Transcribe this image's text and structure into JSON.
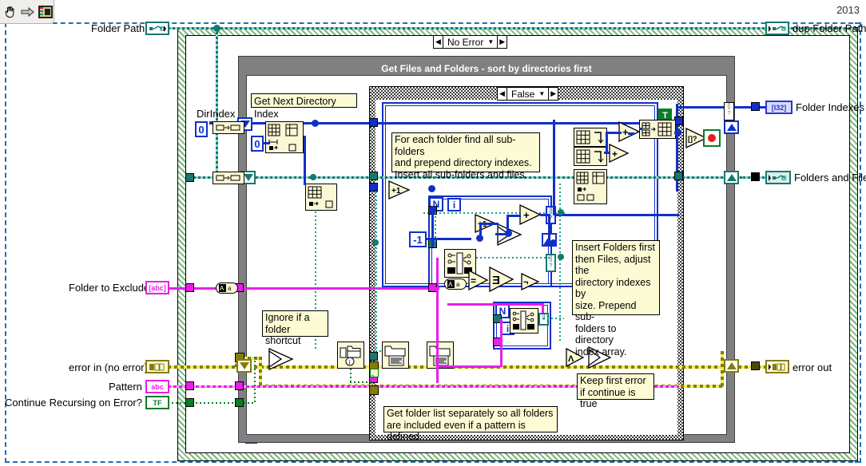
{
  "window": {
    "year_badge": "2013",
    "toolbar": {
      "items": [
        {
          "name": "hand-tool",
          "label": "Hand Tool"
        },
        {
          "name": "run-arrow",
          "label": "Run"
        },
        {
          "name": "vi-icon",
          "label": "VI Icon"
        }
      ]
    }
  },
  "structures": {
    "while_loop_selector": "No Error",
    "case_title": "Get Files and Folders - sort by directories first",
    "inner_case_selector": "False",
    "loop_index_label": "i",
    "count_label": "N"
  },
  "inputs": [
    {
      "name": "folder-path",
      "label": "Folder Path",
      "type": "path",
      "glyph": "path"
    },
    {
      "name": "folder-to-exclude",
      "label": "Folder to Exclude",
      "type": "string",
      "glyph": "[abc]"
    },
    {
      "name": "error-in",
      "label": "error in (no error)",
      "type": "error",
      "glyph": "err"
    },
    {
      "name": "pattern",
      "label": "Pattern",
      "type": "string",
      "glyph": "abc"
    },
    {
      "name": "continue-recursing",
      "label": "Continue Recursing on Error? (F)",
      "type": "boolean",
      "glyph": "TF"
    }
  ],
  "outputs": [
    {
      "name": "dup-folder-path",
      "label": "dup Folder Path",
      "type": "path",
      "glyph": "path"
    },
    {
      "name": "folder-indexes",
      "label": "Folder Indexes",
      "type": "i32-array",
      "glyph": "[I32]"
    },
    {
      "name": "folders-and-files",
      "label": "Folders and Files",
      "type": "path-array",
      "glyph": "path"
    },
    {
      "name": "error-out",
      "label": "error out",
      "type": "error",
      "glyph": "err"
    }
  ],
  "labels": {
    "dir_index": "DirIndex"
  },
  "constants": [
    {
      "name": "dirindex-zero",
      "value": "0"
    },
    {
      "name": "array-index-zero",
      "value": "0"
    },
    {
      "name": "minus-one",
      "value": "-1"
    },
    {
      "name": "true-constant",
      "value": "T"
    }
  ],
  "comments": [
    {
      "name": "comment-get-next-directory-index",
      "text": "Get Next Directory Index"
    },
    {
      "name": "comment-for-each-folder",
      "text": "For each folder find all sub-folders\nand prepend directory indexes.\nInsert all sub-folders and files."
    },
    {
      "name": "comment-insert-folders-first",
      "text": "Insert Folders first\nthen Files, adjust the\ndirectory indexes by\nsize. Prepend sub-\nfolders to directory\nindex array."
    },
    {
      "name": "comment-ignore-if-shortcut",
      "text": "Ignore if a\nfolder shortcut"
    },
    {
      "name": "comment-keep-first-error",
      "text": "Keep first error\nif continue is true"
    },
    {
      "name": "comment-get-folder-list",
      "text": "Get folder list separately so all folders\nare included even if a pattern is defined."
    }
  ],
  "nodes": [
    {
      "name": "index-array-node",
      "glyph": "index-array"
    },
    {
      "name": "delete-from-array-node",
      "glyph": "delete-from-array"
    },
    {
      "name": "array-size-node",
      "glyph": "array-size"
    },
    {
      "name": "insert-into-array-node-1",
      "glyph": "insert-into-array"
    },
    {
      "name": "insert-into-array-node-2",
      "glyph": "insert-into-array"
    },
    {
      "name": "build-array-node",
      "glyph": "build-array"
    },
    {
      "name": "array-subset-node",
      "glyph": "array-subset"
    },
    {
      "name": "search-replace-string-node-1",
      "glyph": "search-replace"
    },
    {
      "name": "search-replace-string-node-2",
      "glyph": "search-replace"
    },
    {
      "name": "to-lower-case-node-1",
      "glyph": "Aa"
    },
    {
      "name": "to-lower-case-node-2",
      "glyph": "Aa"
    },
    {
      "name": "file-info-node",
      "glyph": "file-info"
    },
    {
      "name": "list-folder-node-1",
      "glyph": "list-folder"
    },
    {
      "name": "list-folder-node-2",
      "glyph": "list-folder"
    },
    {
      "name": "increment-node",
      "glyph": "+1"
    },
    {
      "name": "add-node-1",
      "glyph": "+"
    },
    {
      "name": "add-node-2",
      "glyph": "+"
    },
    {
      "name": "add-node-3",
      "glyph": "+"
    },
    {
      "name": "select-node-1",
      "glyph": "select"
    },
    {
      "name": "select-node-2",
      "glyph": "select"
    },
    {
      "name": "select-node-3",
      "glyph": "select"
    },
    {
      "name": "equal-node",
      "glyph": "="
    },
    {
      "name": "or-array-node",
      "glyph": "or-array"
    },
    {
      "name": "not-node",
      "glyph": "not"
    },
    {
      "name": "empty-array-node",
      "glyph": "[]?"
    },
    {
      "name": "and-node",
      "glyph": "and"
    },
    {
      "name": "stop-button",
      "glyph": "stop"
    }
  ]
}
